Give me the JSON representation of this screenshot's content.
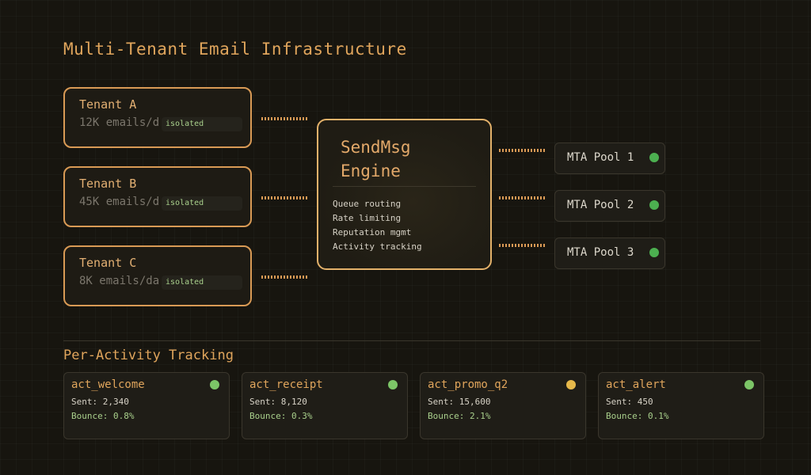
{
  "title": "Multi-Tenant Email Infrastructure",
  "tenants": [
    {
      "name": "Tenant A",
      "rate": "12K emails/day",
      "badge": "isolated"
    },
    {
      "name": "Tenant B",
      "rate": "45K emails/day",
      "badge": "isolated"
    },
    {
      "name": "Tenant C",
      "rate": "8K emails/day",
      "badge": "isolated"
    }
  ],
  "engine": {
    "title": "SendMsg Engine",
    "features": [
      "Queue routing",
      "Rate limiting",
      "Reputation mgmt",
      "Activity tracking"
    ]
  },
  "pools": [
    {
      "label": "MTA Pool 1",
      "status_color": "#4caf50"
    },
    {
      "label": "MTA Pool 2",
      "status_color": "#4caf50"
    },
    {
      "label": "MTA Pool 3",
      "status_color": "#4caf50"
    }
  ],
  "tracking": {
    "title": "Per-Activity Tracking",
    "activities": [
      {
        "name": "act_welcome",
        "sent": "Sent: 2,340",
        "bounce": "Bounce: 0.8%",
        "status_color": "#7cc567"
      },
      {
        "name": "act_receipt",
        "sent": "Sent: 8,120",
        "bounce": "Bounce: 0.3%",
        "status_color": "#7cc567"
      },
      {
        "name": "act_promo_q2",
        "sent": "Sent: 15,600",
        "bounce": "Bounce: 2.1%",
        "status_color": "#e6b84a"
      },
      {
        "name": "act_alert",
        "sent": "Sent: 450",
        "bounce": "Bounce: 0.1%",
        "status_color": "#7cc567"
      }
    ]
  },
  "colors": {
    "accent": "#e0a55c",
    "tenant_border": "#d99a55",
    "engine_border": "#e3b16a",
    "ok": "#4caf50",
    "warn": "#e6b84a"
  }
}
